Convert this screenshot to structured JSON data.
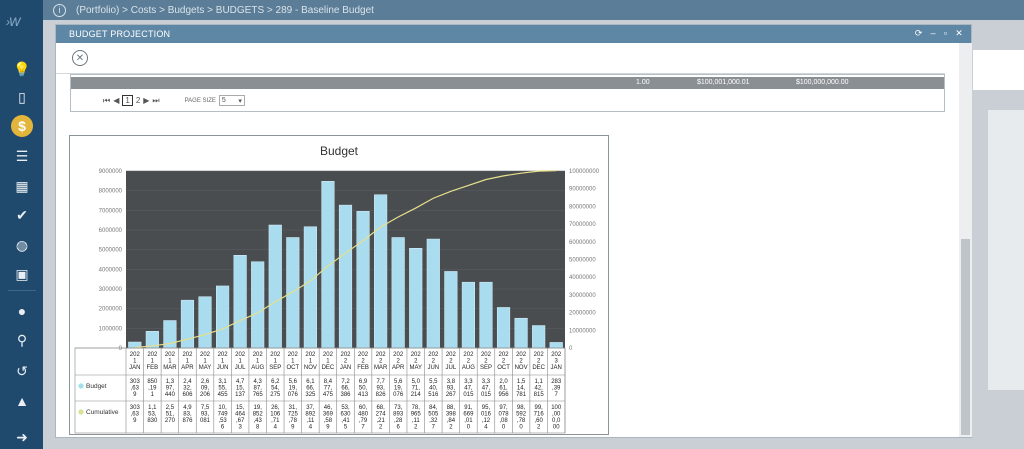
{
  "nav": {
    "icons": [
      "logo-icon",
      "lightbulb-icon",
      "document-icon",
      "dollar-icon",
      "bars-icon",
      "building-icon",
      "check-icon",
      "globe-icon",
      "briefcase-icon",
      "mic-icon",
      "search-icon",
      "history-icon",
      "graduation-icon",
      "logout-icon"
    ],
    "logo": "›W",
    "accent": "#e3b53b"
  },
  "breadcrumb": "(Portfolio) > Costs > Budgets > BUDGETS > 289 - Baseline Budget",
  "modal": {
    "title": "BUDGET PROJECTION",
    "controls": [
      "⟳",
      "–",
      "▫",
      "✕"
    ]
  },
  "grid": {
    "totals": [
      "1.00",
      "$100,001,000.01",
      "$100,000,000.00"
    ],
    "pager": {
      "pages": [
        "1",
        "2"
      ],
      "current": "1",
      "page_size_label": "PAGE SIZE",
      "page_size": "5"
    }
  },
  "chart_data": {
    "type": "bar",
    "title": "Budget",
    "categories": [
      "2021 JAN",
      "2021 FEB",
      "2021 MAR",
      "2021 APR",
      "2021 MAY",
      "2021 JUN",
      "2021 JUL",
      "2021 AUG",
      "2021 SEP",
      "2021 OCT",
      "2021 NOV",
      "2021 DEC",
      "2022 JAN",
      "2022 FEB",
      "2022 MAR",
      "2022 APR",
      "2022 MAY",
      "2022 JUN",
      "2022 JUL",
      "2022 AUG",
      "2022 SEP",
      "2022 OCT",
      "2022 NOV",
      "2022 DEC",
      "2023 JAN"
    ],
    "y_left": {
      "min": 0,
      "max": 9000000,
      "ticks": [
        "0",
        "1000000",
        "2000000",
        "3000000",
        "4000000",
        "5000000",
        "6000000",
        "7000000",
        "8000000",
        "9000000"
      ]
    },
    "y_right": {
      "min": 0,
      "max": 100000000,
      "ticks": [
        "0",
        "10000000",
        "20000000",
        "30000000",
        "40000000",
        "50000000",
        "60000000",
        "70000000",
        "80000000",
        "90000000",
        "100000000"
      ]
    },
    "series": [
      {
        "name": "Budget",
        "type": "bar",
        "axis": "left",
        "color": "#a9dcef",
        "values": [
          303630,
          850190,
          1397440,
          2432606,
          2609206,
          3155455,
          4715137,
          4387765,
          6254275,
          5619076,
          6166325,
          8477475,
          7266386,
          6950413,
          7793826,
          5619076,
          5071214,
          5540516,
          3893267,
          3347015,
          3347015,
          2061956,
          1514781,
          1142815,
          283397
        ],
        "table": [
          "303\n,63\n9",
          "850\n,19\n1",
          "1,3\n97,\n440",
          "2,4\n32,\n606",
          "2,6\n09,\n206",
          "3,1\n55,\n455",
          "4,7\n15,\n137",
          "4,3\n87,\n765",
          "6,2\n54,\n275",
          "5,6\n19,\n076",
          "6,1\n66,\n325",
          "8,4\n77,\n475",
          "7,2\n66,\n386",
          "6,9\n50,\n413",
          "7,7\n93,\n826",
          "5,6\n19,\n076",
          "5,0\n71,\n214",
          "5,5\n40,\n516",
          "3,8\n93,\n267",
          "3,3\n47,\n015",
          "3,3\n47,\n015",
          "2,0\n61,\n956",
          "1,5\n14,\n781",
          "1,1\n42,\n815",
          "283\n,39\n7"
        ]
      },
      {
        "name": "Cumulative",
        "type": "line",
        "axis": "right",
        "color": "#e6e08c",
        "values": [
          303639,
          1153830,
          2551270,
          4983876,
          7593082,
          10749536,
          15464673,
          19852438,
          26106713,
          31725789,
          37892114,
          46369589,
          53636041,
          60586454,
          68379280,
          73998356,
          79069570,
          84610086,
          88503353,
          91850368,
          95197383,
          97259339,
          98774120,
          99916935,
          100200332
        ],
        "table": [
          "303\n,63\n9",
          "1,1\n53,\n830",
          "2,5\n51,\n270",
          "4,9\n83,\n876",
          "7,5\n93,\n081",
          "10,\n749\n,53\n6",
          "15,\n464\n,67\n3",
          "19,\n852\n,43\n8",
          "26,\n106\n,71\n4",
          "31,\n725\n,78\n9",
          "37,\n892\n,11\n4",
          "46,\n369\n,58\n9",
          "53,\n630\n,41\n5",
          "60,\n480\n,79\n7",
          "68,\n274\n,21\n2",
          "73,\n893\n,28\n6",
          "78,\n965\n,11\n2",
          "84,\n505\n,32\n7",
          "88,\n398\n,84\n2",
          "91,\n669\n,01\n0",
          "95,\n016\n,12\n4",
          "97,\n078\n,08\n0",
          "98,\n592\n,78\n0",
          "99,\n716\n,60\n2",
          "100\n,00\n0,0\n00"
        ]
      }
    ]
  }
}
